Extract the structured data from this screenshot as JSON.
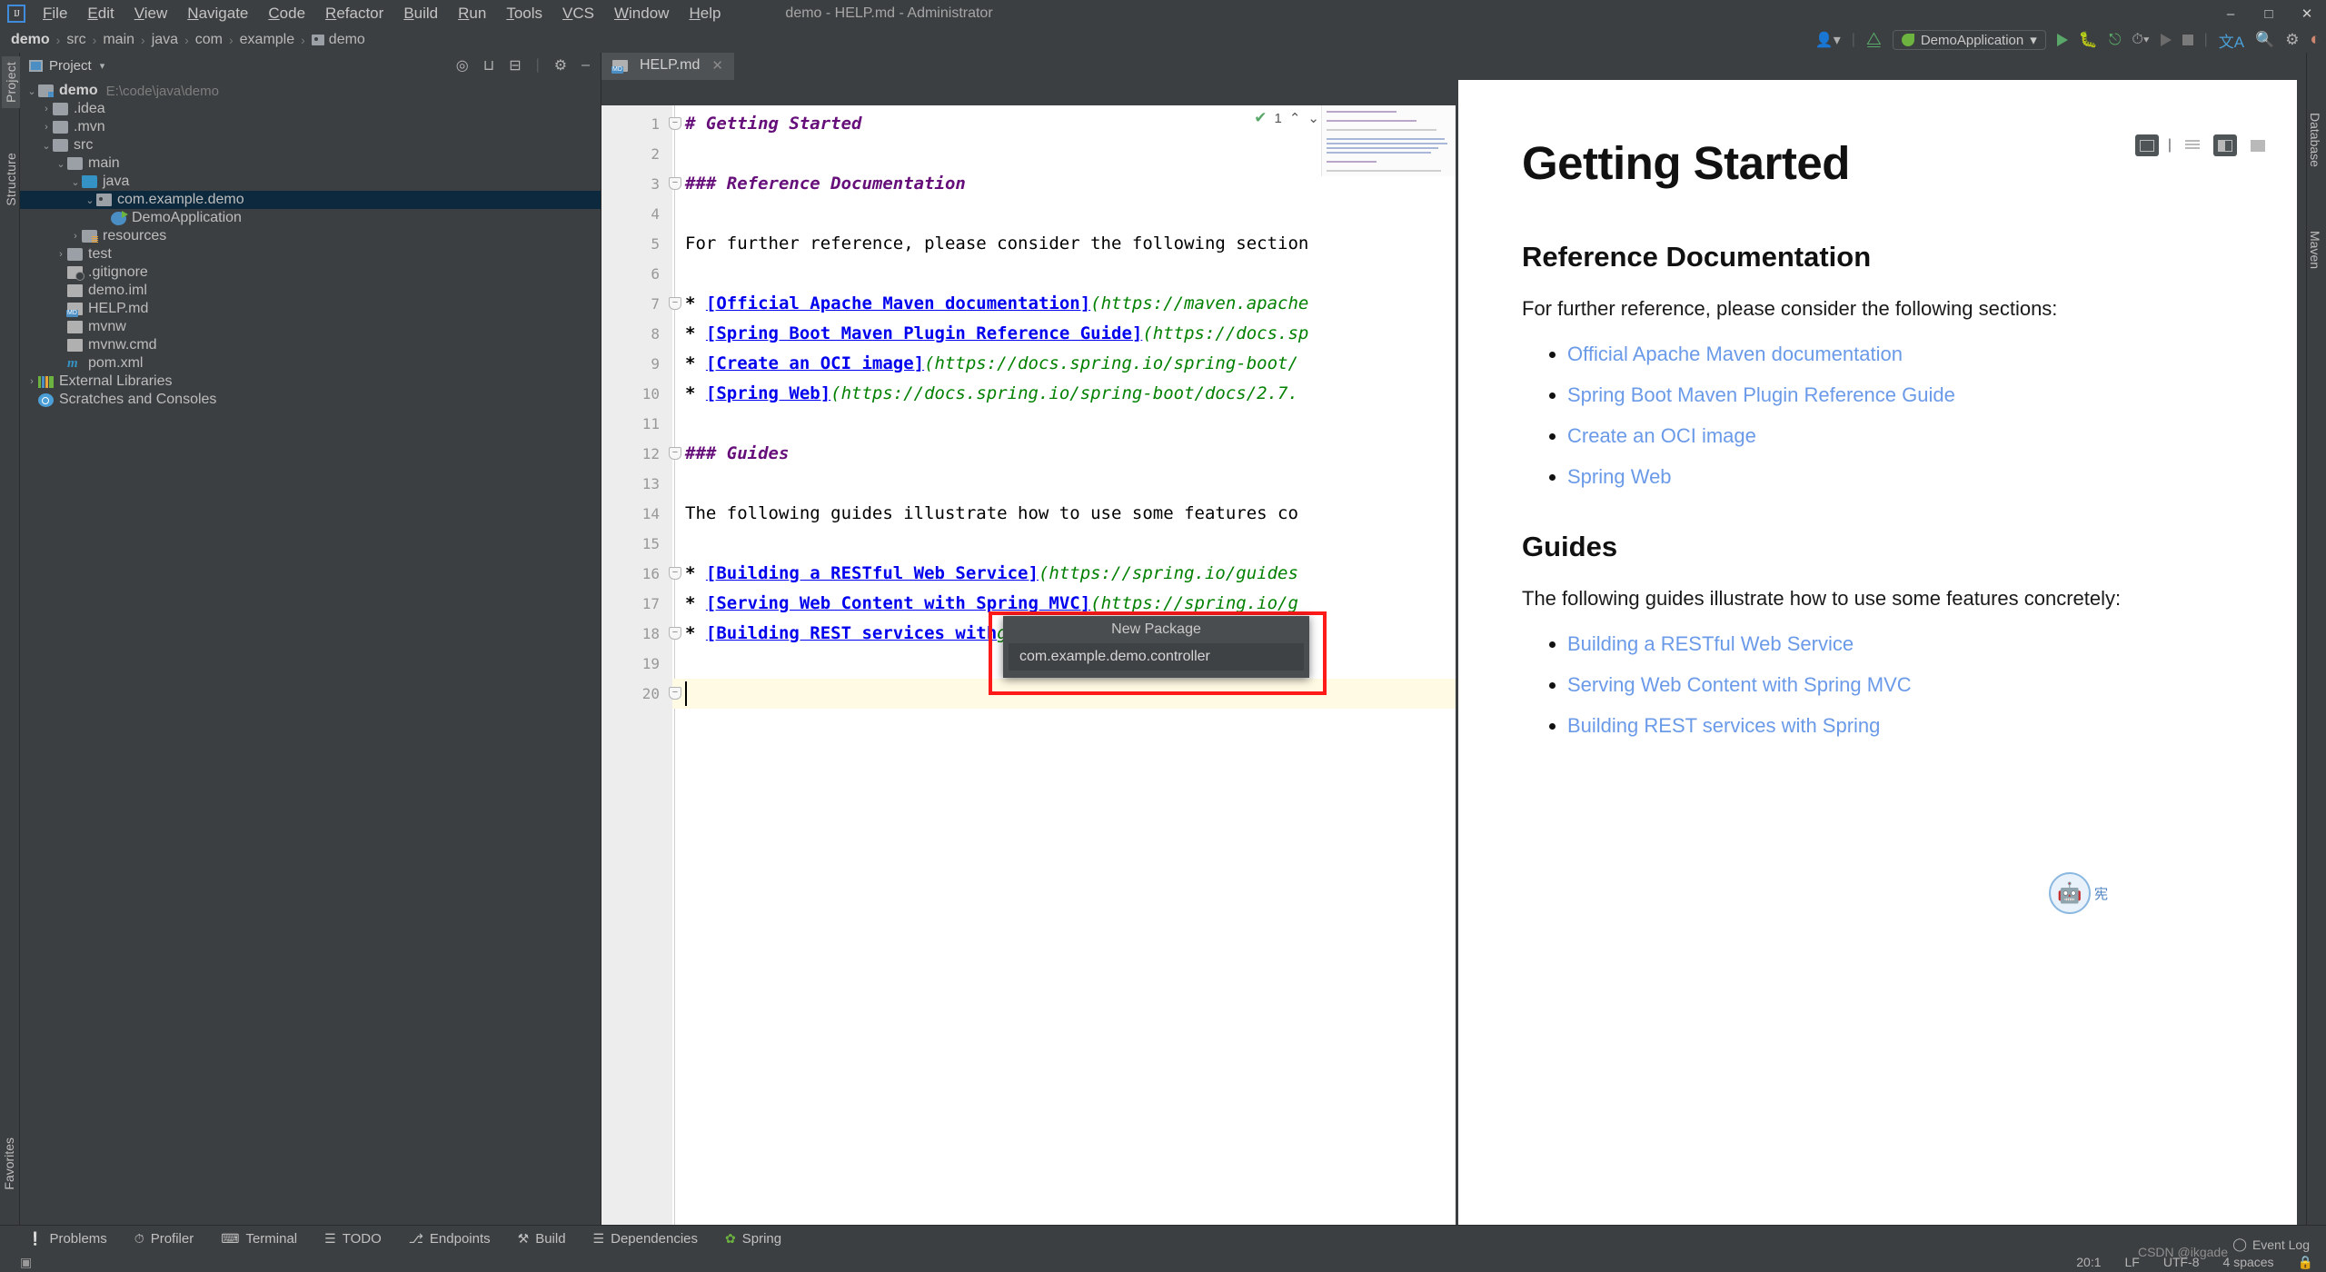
{
  "window": {
    "title": "demo - HELP.md - Administrator",
    "logo": "intellij-logo",
    "minimize": "–",
    "maximize": "□",
    "close": "✕"
  },
  "menubar": {
    "items": [
      "File",
      "Edit",
      "View",
      "Navigate",
      "Code",
      "Refactor",
      "Build",
      "Run",
      "Tools",
      "VCS",
      "Window",
      "Help"
    ]
  },
  "navbar": {
    "crumbs": [
      "demo",
      "src",
      "main",
      "java",
      "com",
      "example",
      "demo"
    ],
    "separator": "›",
    "run_config": "DemoApplication",
    "dropdown_caret": "▾"
  },
  "left_tool_strip": {
    "tabs": [
      "Project",
      "Structure",
      "Favorites"
    ]
  },
  "right_tool_strip": {
    "tabs": [
      "Database",
      "Maven"
    ]
  },
  "project_panel": {
    "title": "Project",
    "caret": "▾",
    "tree": [
      {
        "indent": 0,
        "arrow": "⌄",
        "icon": "folder-module-icon",
        "label": "demo",
        "suffix": "E:\\code\\java\\demo",
        "bold": true,
        "selected": false
      },
      {
        "indent": 1,
        "arrow": "›",
        "icon": "folder-icon",
        "label": ".idea",
        "suffix": "",
        "bold": false,
        "selected": false
      },
      {
        "indent": 1,
        "arrow": "›",
        "icon": "folder-icon",
        "label": ".mvn",
        "suffix": "",
        "bold": false,
        "selected": false
      },
      {
        "indent": 1,
        "arrow": "⌄",
        "icon": "folder-icon",
        "label": "src",
        "suffix": "",
        "bold": false,
        "selected": false
      },
      {
        "indent": 2,
        "arrow": "⌄",
        "icon": "folder-icon",
        "label": "main",
        "suffix": "",
        "bold": false,
        "selected": false
      },
      {
        "indent": 3,
        "arrow": "⌄",
        "icon": "folder-source-icon",
        "label": "java",
        "suffix": "",
        "bold": false,
        "selected": false
      },
      {
        "indent": 4,
        "arrow": "⌄",
        "icon": "package-icon",
        "label": "com.example.demo",
        "suffix": "",
        "bold": false,
        "selected": true
      },
      {
        "indent": 5,
        "arrow": "",
        "icon": "spring-boot-class-icon",
        "label": "DemoApplication",
        "suffix": "",
        "bold": false,
        "selected": false
      },
      {
        "indent": 3,
        "arrow": "›",
        "icon": "folder-resources-icon",
        "label": "resources",
        "suffix": "",
        "bold": false,
        "selected": false
      },
      {
        "indent": 2,
        "arrow": "›",
        "icon": "folder-icon",
        "label": "test",
        "suffix": "",
        "bold": false,
        "selected": false
      },
      {
        "indent": 2,
        "arrow": "",
        "icon": "gitignore-file-icon",
        "label": ".gitignore",
        "suffix": "",
        "bold": false,
        "selected": false
      },
      {
        "indent": 2,
        "arrow": "",
        "icon": "iml-file-icon",
        "label": "demo.iml",
        "suffix": "",
        "bold": false,
        "selected": false
      },
      {
        "indent": 2,
        "arrow": "",
        "icon": "markdown-file-icon",
        "label": "HELP.md",
        "suffix": "",
        "bold": false,
        "selected": false
      },
      {
        "indent": 2,
        "arrow": "",
        "icon": "shell-file-icon",
        "label": "mvnw",
        "suffix": "",
        "bold": false,
        "selected": false
      },
      {
        "indent": 2,
        "arrow": "",
        "icon": "cmd-file-icon",
        "label": "mvnw.cmd",
        "suffix": "",
        "bold": false,
        "selected": false
      },
      {
        "indent": 2,
        "arrow": "",
        "icon": "maven-pom-icon",
        "label": "pom.xml",
        "suffix": "",
        "bold": false,
        "selected": false
      },
      {
        "indent": 0,
        "arrow": "›",
        "icon": "external-libraries-icon",
        "label": "External Libraries",
        "suffix": "",
        "bold": false,
        "selected": false
      },
      {
        "indent": 0,
        "arrow": "",
        "icon": "scratches-icon",
        "label": "Scratches and Consoles",
        "suffix": "",
        "bold": false,
        "selected": false
      }
    ]
  },
  "editor": {
    "tab": {
      "label": "HELP.md",
      "icon": "markdown-file-icon",
      "close": "✕"
    },
    "inspection": {
      "count": "1",
      "up": "⌃",
      "down": "⌄",
      "check": "✔"
    },
    "lines": [
      {
        "n": "1",
        "fold": "−",
        "segments": [
          {
            "t": "# Getting Started",
            "c": "h1"
          }
        ]
      },
      {
        "n": "2",
        "fold": "",
        "segments": []
      },
      {
        "n": "3",
        "fold": "−",
        "segments": [
          {
            "t": "### Reference Documentation",
            "c": "h3"
          }
        ]
      },
      {
        "n": "4",
        "fold": "",
        "segments": []
      },
      {
        "n": "5",
        "fold": "",
        "segments": [
          {
            "t": "For further reference, please consider the following section",
            "c": "plain"
          }
        ]
      },
      {
        "n": "6",
        "fold": "",
        "segments": []
      },
      {
        "n": "7",
        "fold": "−",
        "segments": [
          {
            "t": "* ",
            "c": "bullet"
          },
          {
            "t": "[Official Apache Maven documentation]",
            "c": "lnk"
          },
          {
            "t": "(https://maven.apache",
            "c": "url"
          }
        ]
      },
      {
        "n": "8",
        "fold": "",
        "segments": [
          {
            "t": "* ",
            "c": "bullet"
          },
          {
            "t": "[Spring Boot Maven Plugin Reference Guide]",
            "c": "lnk"
          },
          {
            "t": "(https://docs.sp",
            "c": "url"
          }
        ]
      },
      {
        "n": "9",
        "fold": "",
        "segments": [
          {
            "t": "* ",
            "c": "bullet"
          },
          {
            "t": "[Create an OCI image]",
            "c": "lnk"
          },
          {
            "t": "(https://docs.spring.io/spring-boot/",
            "c": "url"
          }
        ]
      },
      {
        "n": "10",
        "fold": "",
        "segments": [
          {
            "t": "* ",
            "c": "bullet"
          },
          {
            "t": "[Spring Web]",
            "c": "lnk"
          },
          {
            "t": "(https://docs.spring.io/spring-boot/docs/2.7.",
            "c": "url"
          }
        ]
      },
      {
        "n": "11",
        "fold": "",
        "segments": []
      },
      {
        "n": "12",
        "fold": "−",
        "segments": [
          {
            "t": "### Guides",
            "c": "h3"
          }
        ]
      },
      {
        "n": "13",
        "fold": "",
        "segments": []
      },
      {
        "n": "14",
        "fold": "",
        "segments": [
          {
            "t": "The following guides illustrate how to use some features co",
            "c": "plain"
          }
        ]
      },
      {
        "n": "15",
        "fold": "",
        "segments": []
      },
      {
        "n": "16",
        "fold": "−",
        "segments": [
          {
            "t": "* ",
            "c": "bullet"
          },
          {
            "t": "[Building a RESTful Web Service]",
            "c": "lnk"
          },
          {
            "t": "(https://spring.io/guides",
            "c": "url"
          }
        ]
      },
      {
        "n": "17",
        "fold": "",
        "segments": [
          {
            "t": "* ",
            "c": "bullet"
          },
          {
            "t": "[Serving Web Content with Spring MVC]",
            "c": "lnk"
          },
          {
            "t": "(https://spring.io/g",
            "c": "url"
          }
        ]
      },
      {
        "n": "18",
        "fold": "−",
        "segments": [
          {
            "t": "* ",
            "c": "bullet"
          },
          {
            "t": "[Building REST services with",
            "c": "lnk"
          },
          {
            "t": "gu",
            "c": "url"
          }
        ]
      },
      {
        "n": "19",
        "fold": "",
        "segments": []
      },
      {
        "n": "20",
        "fold": "−",
        "segments": []
      }
    ],
    "view_modes": [
      "soft-wrap-toggle",
      "editor-only",
      "editor-and-preview",
      "preview-only"
    ]
  },
  "preview": {
    "h1": "Getting Started",
    "sections": [
      {
        "heading": "Reference Documentation",
        "paragraph": "For further reference, please consider the following sections:",
        "links": [
          "Official Apache Maven documentation",
          "Spring Boot Maven Plugin Reference Guide",
          "Create an OCI image",
          "Spring Web"
        ]
      },
      {
        "heading": "Guides",
        "paragraph": "The following guides illustrate how to use some features concretely:",
        "links": [
          "Building a RESTful Web Service",
          "Serving Web Content with Spring MVC",
          "Building REST services with Spring"
        ]
      }
    ]
  },
  "new_package_popup": {
    "title": "New Package",
    "value": "com.example.demo.controller",
    "highlight_color": "#ff1a1a"
  },
  "bottom_bar": {
    "items": [
      {
        "icon": "problems-icon",
        "label": "Problems"
      },
      {
        "icon": "profiler-icon",
        "label": "Profiler"
      },
      {
        "icon": "terminal-icon",
        "label": "Terminal"
      },
      {
        "icon": "todo-icon",
        "label": "TODO"
      },
      {
        "icon": "endpoints-icon",
        "label": "Endpoints"
      },
      {
        "icon": "build-icon",
        "label": "Build"
      },
      {
        "icon": "dependencies-icon",
        "label": "Dependencies"
      },
      {
        "icon": "spring-icon",
        "label": "Spring"
      }
    ]
  },
  "status_bar": {
    "event_log": "Event Log",
    "caret_position": "20:1",
    "line_separator": "LF",
    "encoding": "UTF-8",
    "indent": "4 spaces",
    "lock_icon": "lock-icon"
  },
  "watermark": {
    "text": "CSDN @ikgade",
    "badge": "宪"
  },
  "colors": {
    "accent_blue": "#4b8ec4",
    "spring_green": "#6db33f",
    "selection": "#0d293e",
    "link": "#6a9ae8",
    "markdown_heading": "#660e7a",
    "markdown_link": "#0000ee",
    "markdown_url": "#008000",
    "highlight_red": "#ff1a1a"
  }
}
